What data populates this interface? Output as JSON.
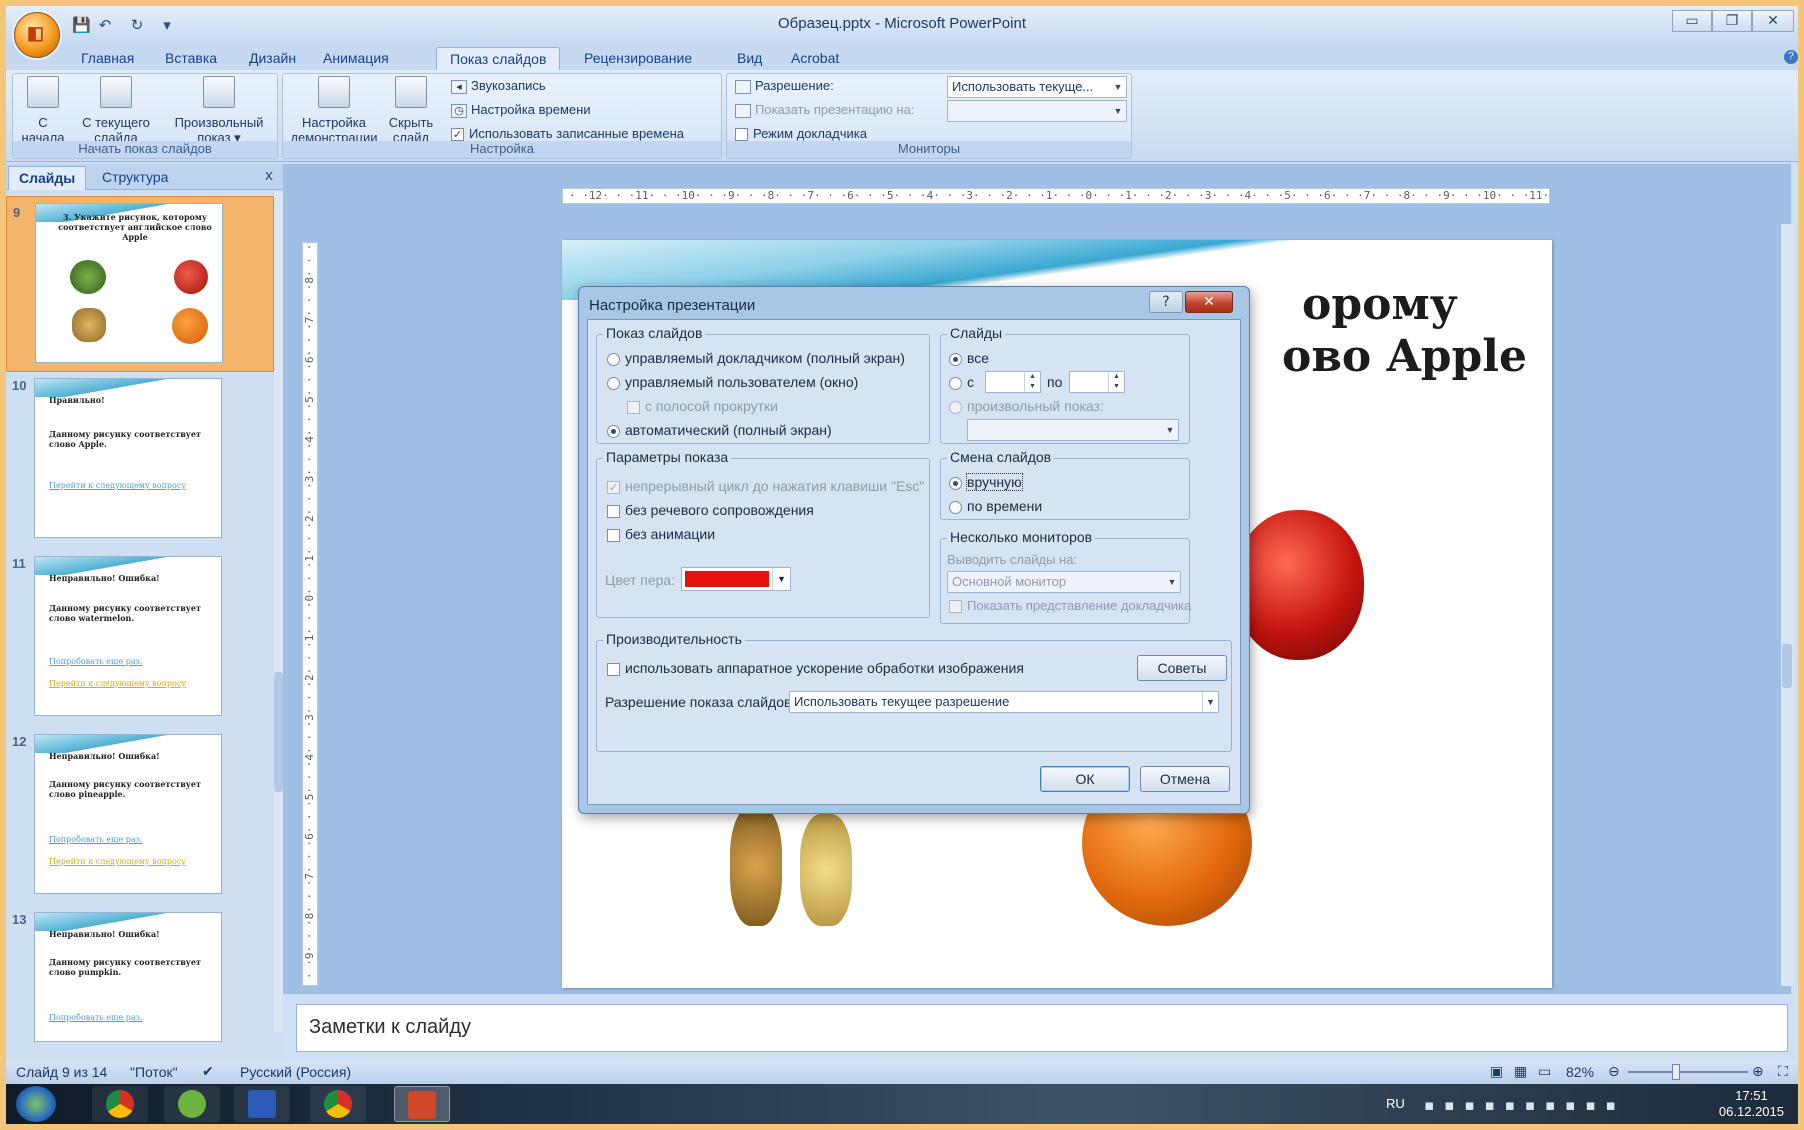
{
  "window": {
    "title": "Образец.pptx - Microsoft PowerPoint",
    "qat_icons": [
      "save-icon",
      "undo-icon",
      "redo-icon",
      "customize-icon"
    ]
  },
  "ribbon": {
    "tabs": [
      "Главная",
      "Вставка",
      "Дизайн",
      "Анимация",
      "Показ слайдов",
      "Рецензирование",
      "Вид",
      "Acrobat"
    ],
    "active_tab": "Показ слайдов",
    "group_start": {
      "label": "Начать показ слайдов",
      "btn_from_start": [
        "С",
        "начала"
      ],
      "btn_from_current": [
        "С текущего",
        "слайда"
      ],
      "btn_custom": [
        "Произвольный",
        "показ ▾"
      ]
    },
    "group_setup": {
      "label": "Настройка",
      "btn_setup": [
        "Настройка",
        "демонстрации"
      ],
      "btn_hide": [
        "Скрыть",
        "слайд"
      ],
      "record_narration": "Звукозапись",
      "rehearse": "Настройка времени",
      "use_timings": "Использовать записанные времена"
    },
    "group_monitors": {
      "label": "Мониторы",
      "resolution_label": "Разрешение:",
      "resolution_value": "Использовать текуще...",
      "show_on_label": "Показать презентацию на:",
      "presenter_view": "Режим докладчика"
    }
  },
  "left_pane": {
    "tab_slides": "Слайды",
    "tab_outline": "Структура",
    "close": "x",
    "thumbs": [
      {
        "num": "9",
        "title": "3. Укажите рисунок, которому соответствует английское слово Apple"
      },
      {
        "num": "10",
        "title": "Правильно!",
        "body": "Данному рисунку соответствует слово Apple.",
        "link1": "Перейти к следующему вопросу"
      },
      {
        "num": "11",
        "title": "Неправильно! Ошибка!",
        "body": "Данному рисунку соответствует слово watermelon.",
        "link1": "Попробовать еще раз.",
        "link2": "Перейти к следующему вопросу"
      },
      {
        "num": "12",
        "title": "Неправильно! Ошибка!",
        "body": "Данному рисунку соответствует слово pineapple.",
        "link1": "Попробовать еще раз.",
        "link2": "Перейти к следующему вопросу"
      },
      {
        "num": "13",
        "title": "Неправильно! Ошибка!",
        "body": "Данному рисунку соответствует слово pumpkin.",
        "link1": "Попробовать еще раз."
      }
    ]
  },
  "ruler_h": "· ·12· · ·11· · ·10· · ·9· · ·8· · ·7· · ·6· · ·5· · ·4· · ·3· · ·2· · ·1· · ·0· · ·1· · ·2· · ·3· · ·4· · ·5· · ·6· · ·7· · ·8· · ·9· · ·10· · ·11· · ·12· ·",
  "ruler_v": "· ·9· · ·8· · ·7· · ·6· · ·5· · ·4· · ·3· · ·2· · ·1· · ·0· · ·1· · ·2· · ·3· · ·4· · ·5· · ·6· · ·7· · ·8· · ·9· ·",
  "slide": {
    "title_line1": "3. Укажите рисунок, которому",
    "title_visible_right1": "орому",
    "title_visible_right2": "ово  Apple"
  },
  "notes_placeholder": "Заметки к слайду",
  "status": {
    "slide_counter": "Слайд 9 из 14",
    "theme": "\"Поток\"",
    "language": "Русский (Россия)",
    "zoom": "82%"
  },
  "taskbar": {
    "lang": "RU",
    "time": "17:51",
    "date": "06.12.2015"
  },
  "dialog": {
    "title": "Настройка презентации",
    "help": "?",
    "close": "✕",
    "show_type": {
      "legend": "Показ слайдов",
      "opt_presenter": "управляемый докладчиком (полный экран)",
      "opt_individual": "управляемый пользователем (окно)",
      "chk_scrollbar": "с полосой прокрутки",
      "opt_kiosk": "автоматический (полный экран)"
    },
    "show_options": {
      "legend": "Параметры показа",
      "loop": "непрерывный цикл до нажатия клавиши \"Esc\"",
      "no_narration": "без речевого сопровождения",
      "no_animation": "без анимации",
      "pen_color_label": "Цвет пера:",
      "pen_color": "#e8120c"
    },
    "slides": {
      "legend": "Слайды",
      "opt_all": "все",
      "opt_from": "с",
      "to": "по",
      "opt_custom": "произвольный показ:"
    },
    "advance": {
      "legend": "Смена слайдов",
      "opt_manual": "вручную",
      "opt_timings": "по времени"
    },
    "monitors": {
      "legend": "Несколько мониторов",
      "display_on_label": "Выводить слайды на:",
      "display_on_value": "Основной монитор",
      "presenter_view": "Показать представление докладчика"
    },
    "performance": {
      "legend": "Производительность",
      "hw_accel": "использовать аппаратное ускорение обработки изображения",
      "tips": "Советы",
      "resolution_label": "Разрешение показа слайдов:",
      "resolution_value": "Использовать текущее разрешение"
    },
    "ok": "ОК",
    "cancel": "Отмена"
  }
}
